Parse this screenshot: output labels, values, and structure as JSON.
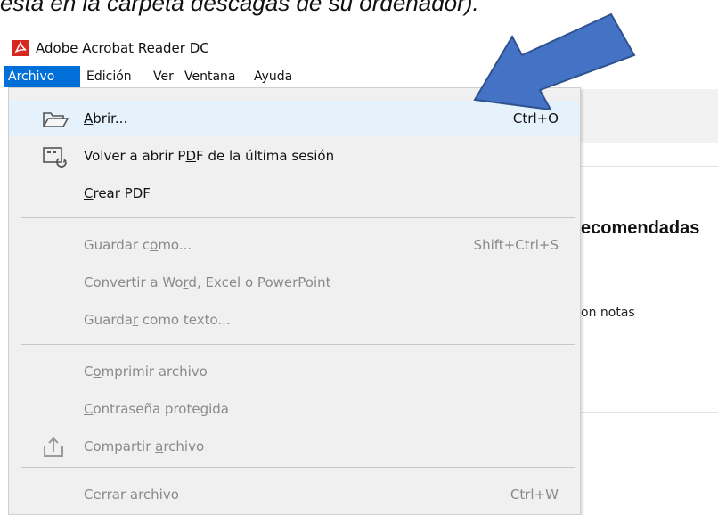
{
  "caption": "está en la carpeta descagas de su ordenador).",
  "window": {
    "title": "Adobe Acrobat Reader DC",
    "icon": "acrobat-logo-icon",
    "accent": "#d7281f"
  },
  "menubar": {
    "items": [
      {
        "label": "Archivo",
        "active": true
      },
      {
        "label": "Edición"
      },
      {
        "label": "Ver"
      },
      {
        "label": "Ventana"
      },
      {
        "label": "Ayuda"
      }
    ],
    "active_color": "#0070d8"
  },
  "background": {
    "heading_fragment": "ecomendadas",
    "notes_fragment": "on notas"
  },
  "file_menu": {
    "items": [
      {
        "pre": "",
        "mn": "A",
        "post": "brir...",
        "shortcut": "Ctrl+O",
        "icon": "open-folder-icon",
        "enabled": true,
        "highlighted": true
      },
      {
        "pre": "Volver a abrir P",
        "mn": "D",
        "post": "F de la última sesión",
        "shortcut": "",
        "icon": "reopen-document-icon",
        "enabled": true
      },
      {
        "pre": "",
        "mn": "C",
        "post": "rear PDF",
        "shortcut": "",
        "icon": "",
        "enabled": true
      },
      {
        "pre": "Guardar c",
        "mn": "o",
        "post": "mo...",
        "shortcut": "Shift+Ctrl+S",
        "icon": "",
        "enabled": false
      },
      {
        "pre": "Convertir a Wo",
        "mn": "r",
        "post": "d, Excel o PowerPoint",
        "shortcut": "",
        "icon": "",
        "enabled": false
      },
      {
        "pre": "Guarda",
        "mn": "r",
        "post": " como texto...",
        "shortcut": "",
        "icon": "",
        "enabled": false
      },
      {
        "pre": "C",
        "mn": "o",
        "post": "mprimir archivo",
        "shortcut": "",
        "icon": "",
        "enabled": false
      },
      {
        "pre": "",
        "mn": "C",
        "post": "ontraseña protegida",
        "shortcut": "",
        "icon": "",
        "enabled": false
      },
      {
        "pre": "Compartir ",
        "mn": "a",
        "post": "rchivo",
        "shortcut": "",
        "icon": "share-upload-icon",
        "enabled": false
      },
      {
        "pre": "Cerrar archivo",
        "mn": "",
        "post": "",
        "shortcut": "Ctrl+W",
        "icon": "",
        "enabled": false
      }
    ]
  },
  "annotation": {
    "icon": "pointer-arrow-icon",
    "color": "#4472c4",
    "outline": "#2f528f"
  }
}
